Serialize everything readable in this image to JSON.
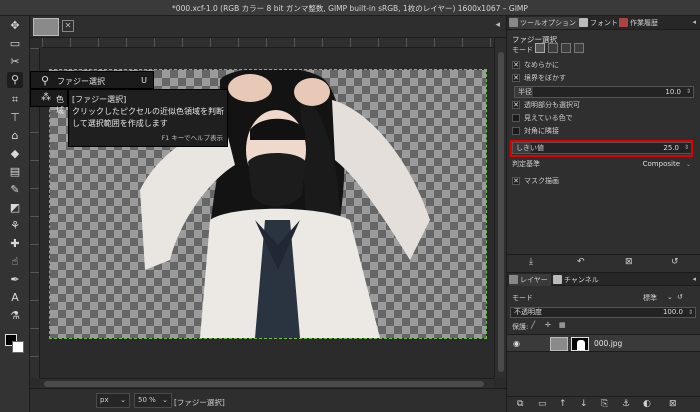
{
  "window": {
    "title": "*000.xcf-1.0 (RGB カラー 8 bit ガンマ整数, GIMP built-in sRGB, 1枚のレイヤー) 1600x1067 – GIMP"
  },
  "toolbox": {
    "icons": [
      "move-tool-icon",
      "rect-select-icon",
      "lasso-icon",
      "fuzzy-select-icon",
      "crop-icon",
      "transform-icon",
      "warp-icon",
      "bucket-fill-icon",
      "gradient-icon",
      "paintbrush-icon",
      "eraser-icon",
      "clone-icon",
      "heal-icon",
      "smudge-icon",
      "path-icon",
      "text-icon",
      "color-picker-icon",
      "zoom-icon"
    ]
  },
  "flyout": {
    "label": "ファジー選択",
    "shortcut": "U",
    "second_label": "色域"
  },
  "tooltip": {
    "title": "[ファジー選択]",
    "description": "クリックしたピクセルの近似色領域を判断して選択範囲を作成します",
    "help": "F1 キーでヘルプ表示"
  },
  "statusbar": {
    "unit": "px",
    "zoom": "50 %",
    "message": "[ファジー選択]"
  },
  "dock": {
    "tabs": [
      "ツールオプション",
      "フォント",
      "作業履歴"
    ],
    "title": "ファジー選択",
    "mode_label": "モード",
    "options": [
      {
        "label": "なめらかに",
        "checked": true
      },
      {
        "label": "境界をぼかす",
        "checked": true
      }
    ],
    "radius": {
      "label": "半径",
      "value": "10.0"
    },
    "options2": [
      {
        "label": "透明部分も選択可",
        "checked": true
      },
      {
        "label": "見えている色で",
        "checked": false
      },
      {
        "label": "対角に隣接",
        "checked": false
      }
    ],
    "threshold": {
      "label": "しきい値",
      "value": "25.0"
    },
    "criterion": {
      "label": "判定基準",
      "value": "Composite"
    },
    "mask": {
      "label": "マスク描画",
      "checked": true
    }
  },
  "layers": {
    "tabs": [
      "レイヤー",
      "チャンネル"
    ],
    "mode_label": "モード",
    "mode_value": "標準",
    "opacity_label": "不透明度",
    "opacity_value": "100.0",
    "lock_label": "保護:",
    "layer_name": "000.jpg"
  },
  "colors": {
    "accent_highlight": "#e00000",
    "selection_marquee": "#6fbf55"
  }
}
